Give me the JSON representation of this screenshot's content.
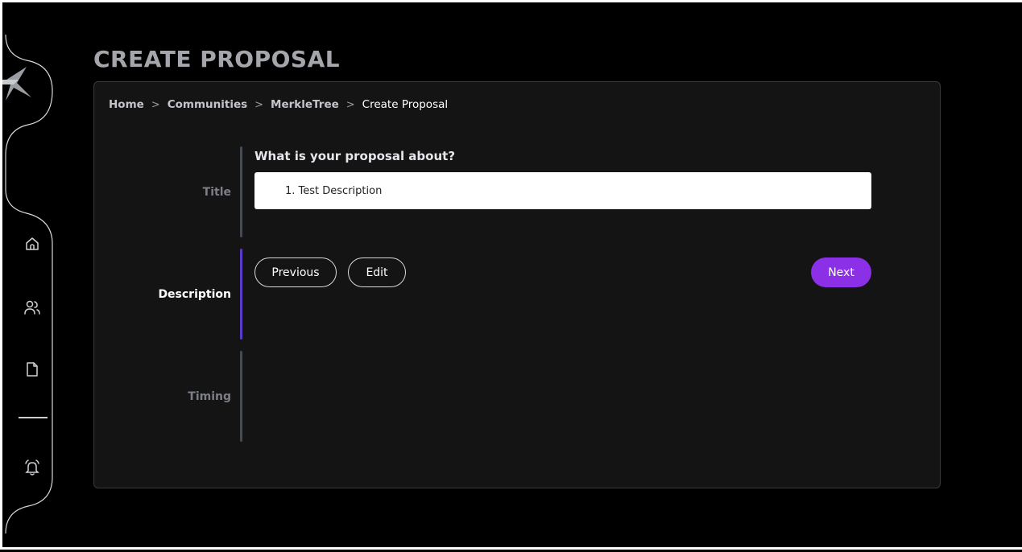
{
  "page": {
    "title": "CREATE PROPOSAL"
  },
  "breadcrumb": {
    "items": [
      "Home",
      "Communities",
      "MerkleTree",
      "Create Proposal"
    ],
    "separator": ">"
  },
  "steps": [
    {
      "label": "Title",
      "active": false
    },
    {
      "label": "Description",
      "active": true
    },
    {
      "label": "Timing",
      "active": false
    }
  ],
  "form": {
    "question": "What is your proposal about?",
    "title_value": "1. Test Description"
  },
  "actions": {
    "previous_label": "Previous",
    "edit_label": "Edit",
    "next_label": "Next"
  },
  "sidebar": {
    "icons": [
      "home-icon",
      "users-icon",
      "document-icon",
      "bell-icon"
    ]
  },
  "colors": {
    "background": "#000000",
    "card": "#141414",
    "accent": "#8b30e6",
    "active_step": "#5b3cc7",
    "title": "#a4a6ab"
  }
}
